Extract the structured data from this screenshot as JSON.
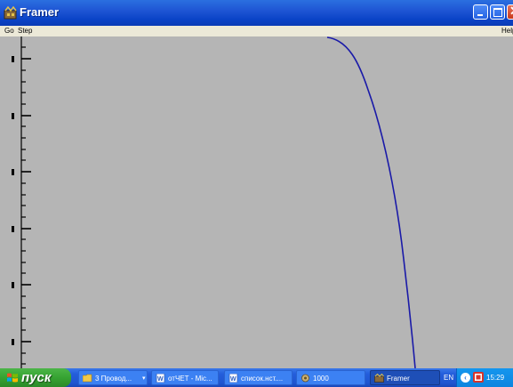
{
  "window": {
    "title": "Framer"
  },
  "menu": {
    "go": "Go",
    "step": "Step",
    "help": "Help"
  },
  "plot": {
    "axis_color": "#000000",
    "curve_color": "#1a1aa8",
    "background": "#b5b5b5"
  },
  "taskbar": {
    "start_label": "пуск",
    "tasks": [
      {
        "label": "3 Провод...",
        "icon": "folder-icon"
      },
      {
        "label": "отЧЕТ - Mic...",
        "icon": "word-document-icon"
      },
      {
        "label": "список.нст....",
        "icon": "word-document-icon"
      },
      {
        "label": "1000",
        "icon": "app-icon"
      },
      {
        "label": "Framer",
        "icon": "framer-icon",
        "active": true
      }
    ],
    "language": "EN",
    "clock": "15:29"
  }
}
